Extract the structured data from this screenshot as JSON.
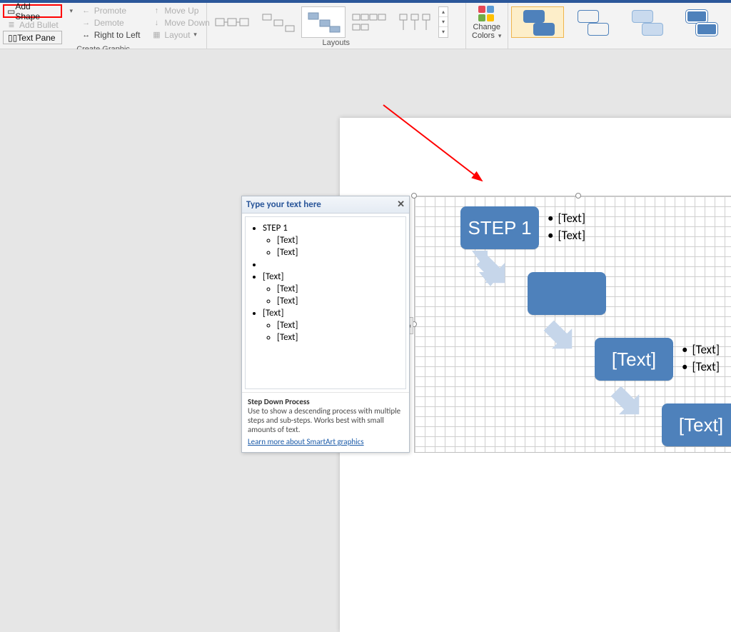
{
  "ribbon": {
    "create_graphic": {
      "label": "Create Graphic",
      "add_shape": "Add Shape",
      "add_bullet": "Add Bullet",
      "text_pane": "Text Pane",
      "promote": "Promote",
      "demote": "Demote",
      "right_to_left": "Right to Left",
      "move_up": "Move Up",
      "move_down": "Move Down",
      "layout_btn": "Layout"
    },
    "layouts": {
      "label": "Layouts"
    },
    "change_colors": {
      "line1": "Change",
      "line2": "Colors"
    }
  },
  "text_pane": {
    "title": "Type your text here",
    "items": [
      {
        "t": "STEP 1",
        "sub": [
          "[Text]",
          "[Text]"
        ]
      },
      {
        "t": "",
        "sub": []
      },
      {
        "t": "[Text]",
        "sub": [
          "[Text]",
          "[Text]"
        ]
      },
      {
        "t": "[Text]",
        "sub": [
          "[Text]",
          "[Text]"
        ]
      }
    ],
    "footer": {
      "title": "Step Down Process",
      "desc": "Use to show a descending process with multiple steps and sub-steps. Works best with small amounts of text.",
      "link": "Learn more about SmartArt graphics"
    }
  },
  "diagram": {
    "steps": [
      {
        "label": "STEP 1",
        "subs": [
          "[Text]",
          "[Text]"
        ]
      },
      {
        "label": "",
        "subs": []
      },
      {
        "label": "[Text]",
        "subs": [
          "[Text]",
          "[Text]"
        ]
      },
      {
        "label": "[Text]",
        "subs": []
      }
    ]
  }
}
